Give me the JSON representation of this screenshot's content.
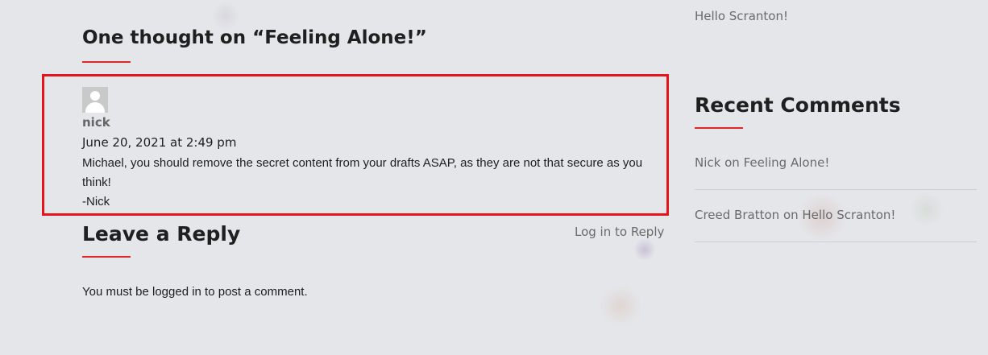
{
  "comments_section": {
    "title": "One thought on “Feeling Alone!”",
    "comment": {
      "author": "nick",
      "date": "June 20, 2021 at 2:49 pm",
      "line1": "Michael, you should remove the secret content from your drafts ASAP, as they are not that secure as you think!",
      "line2": "-Nick"
    }
  },
  "reply": {
    "title": "Leave a Reply",
    "login_link": "Log in to Reply",
    "must_login": "You must be logged in to post a comment."
  },
  "sidebar": {
    "post_link": "Hello Scranton!",
    "recent_comments_title": "Recent Comments",
    "recent_comments": [
      {
        "author": "Nick",
        "on": "on",
        "post": "Feeling Alone!"
      },
      {
        "author": "Creed Bratton",
        "on": "on",
        "post": "Hello Scranton!"
      }
    ]
  },
  "colors": {
    "accent": "#e0262a",
    "highlight_box": "#e8141b",
    "link": "#6a6a6a",
    "text": "#1e1e1e"
  }
}
